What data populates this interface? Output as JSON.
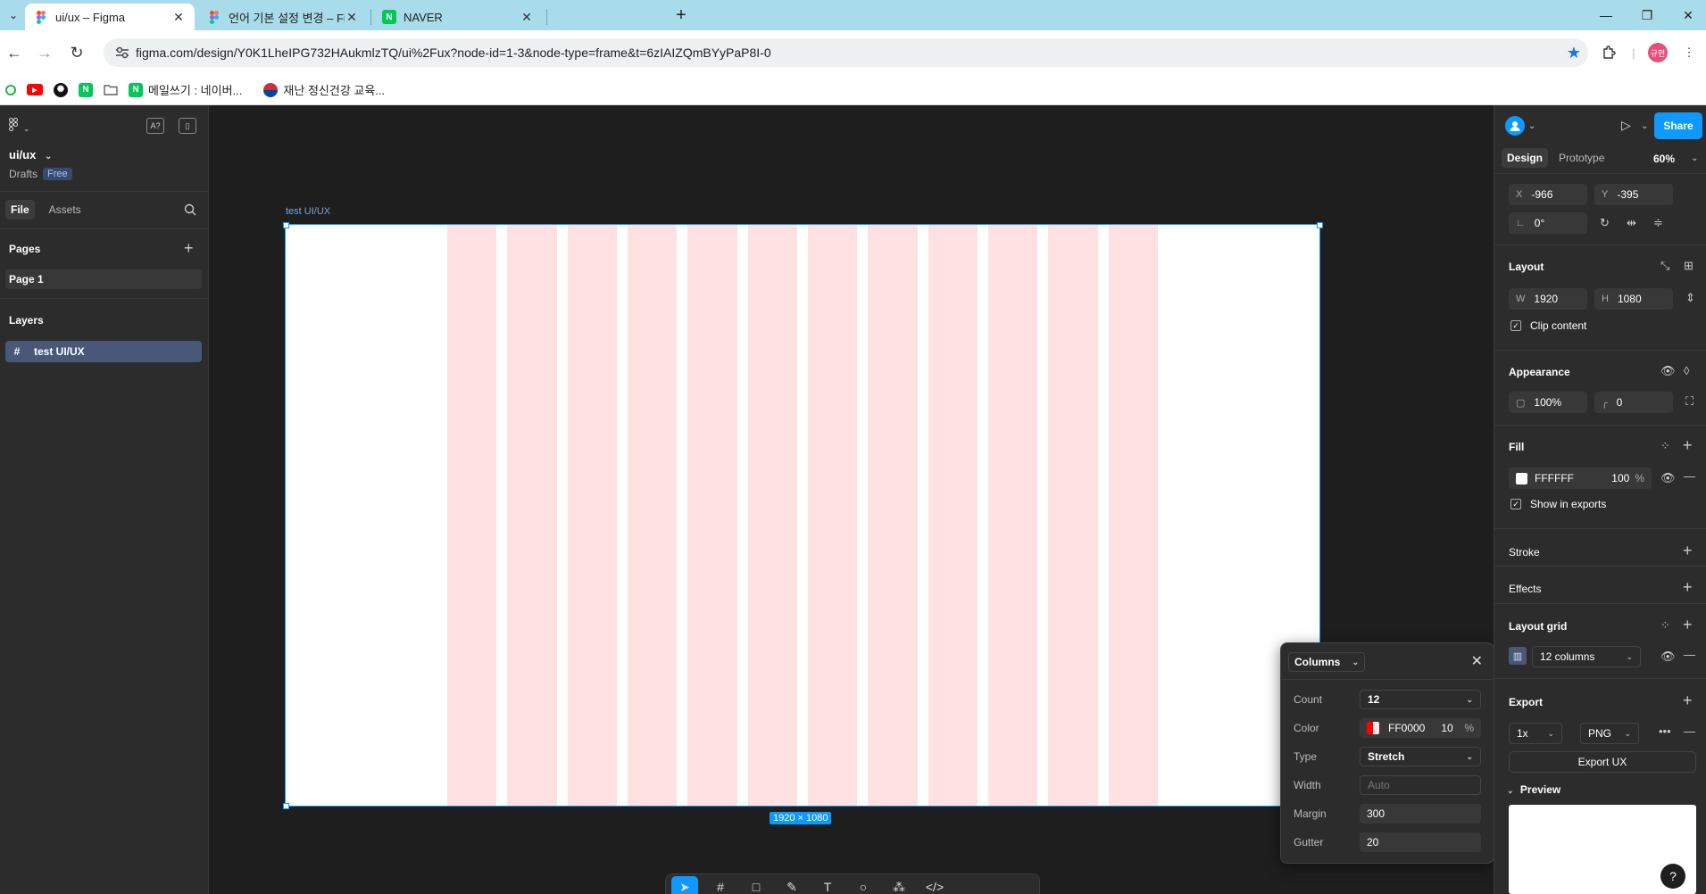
{
  "browser": {
    "tabs": [
      {
        "title": "ui/ux – Figma",
        "active": true
      },
      {
        "title": "언어 기본 설정 변경 – Figma L",
        "active": false
      },
      {
        "title": "NAVER",
        "active": false
      }
    ],
    "url": "figma.com/design/Y0K1LheIPG732HAukmlzTQ/ui%2Fux?node-id=1-3&node-type=frame&t=6zIAIZQmBYyPaP8I-0",
    "bookmarks": [
      {
        "label": "",
        "icon": "circle-green-icon",
        "color": "#28b446"
      },
      {
        "label": "",
        "icon": "youtube-icon",
        "color": "#ff0000"
      },
      {
        "label": "",
        "icon": "chatgpt-icon",
        "color": "#111111"
      },
      {
        "label": "",
        "icon": "naver-icon",
        "color": "#03c75a"
      },
      {
        "label": "",
        "icon": "folder-icon",
        "color": "#5f6368"
      },
      {
        "label": "메일쓰기 : 네이버...",
        "icon": "naver-icon",
        "color": "#03c75a"
      },
      {
        "label": "재난 정신건강 교육...",
        "icon": "korea-flag-icon",
        "color": "#cd2e3a"
      }
    ],
    "profile_initials": "규현"
  },
  "figma": {
    "file_name": "ui/ux",
    "drafts_label": "Drafts",
    "plan_badge": "Free",
    "left_tabs": [
      "File",
      "Assets"
    ],
    "pages_title": "Pages",
    "pages": [
      "Page 1"
    ],
    "layers_title": "Layers",
    "layers": [
      "test UI/UX"
    ],
    "lp_button_label": "A?",
    "frame_label": "test UI/UX",
    "frame_size_badge": "1920 × 1080",
    "grid": {
      "count": 12,
      "color": "#ff0000",
      "opacity": 10,
      "margin": 300,
      "gutter": 20,
      "frame_width": 1920
    },
    "grid_popup": {
      "title": "Columns",
      "count_label": "Count",
      "count_value": "12",
      "color_label": "Color",
      "color_hex": "FF0000",
      "color_opacity": "10",
      "percent": "%",
      "type_label": "Type",
      "type_value": "Stretch",
      "width_label": "Width",
      "width_placeholder": "Auto",
      "margin_label": "Margin",
      "margin_value": "300",
      "gutter_label": "Gutter",
      "gutter_value": "20"
    },
    "toolbar_tools": [
      "move-tool-icon",
      "frame-tool-icon",
      "rectangle-tool-icon",
      "pen-tool-icon",
      "text-tool-icon",
      "comment-tool-icon",
      "actions-tool-icon",
      "dev-mode-icon"
    ],
    "right": {
      "share": "Share",
      "tabs": [
        "Design",
        "Prototype"
      ],
      "zoom": "60%",
      "x_label": "X",
      "x": "-966",
      "y_label": "Y",
      "y": "-395",
      "rotation": "0°",
      "layout_title": "Layout",
      "w_label": "W",
      "w": "1920",
      "h_label": "H",
      "h": "1080",
      "clip_content": "Clip content",
      "appearance_title": "Appearance",
      "opacity": "100%",
      "radius": "0",
      "fill_title": "Fill",
      "fill_hex": "FFFFFF",
      "fill_opacity": "100",
      "fill_percent": "%",
      "show_in_exports": "Show in exports",
      "stroke_title": "Stroke",
      "effects_title": "Effects",
      "layout_grid_title": "Layout grid",
      "layout_grid_value": "12 columns",
      "export_title": "Export",
      "export_scale": "1x",
      "export_format": "PNG",
      "export_button": "Export UX",
      "preview_label": "Preview",
      "help": "?"
    }
  }
}
